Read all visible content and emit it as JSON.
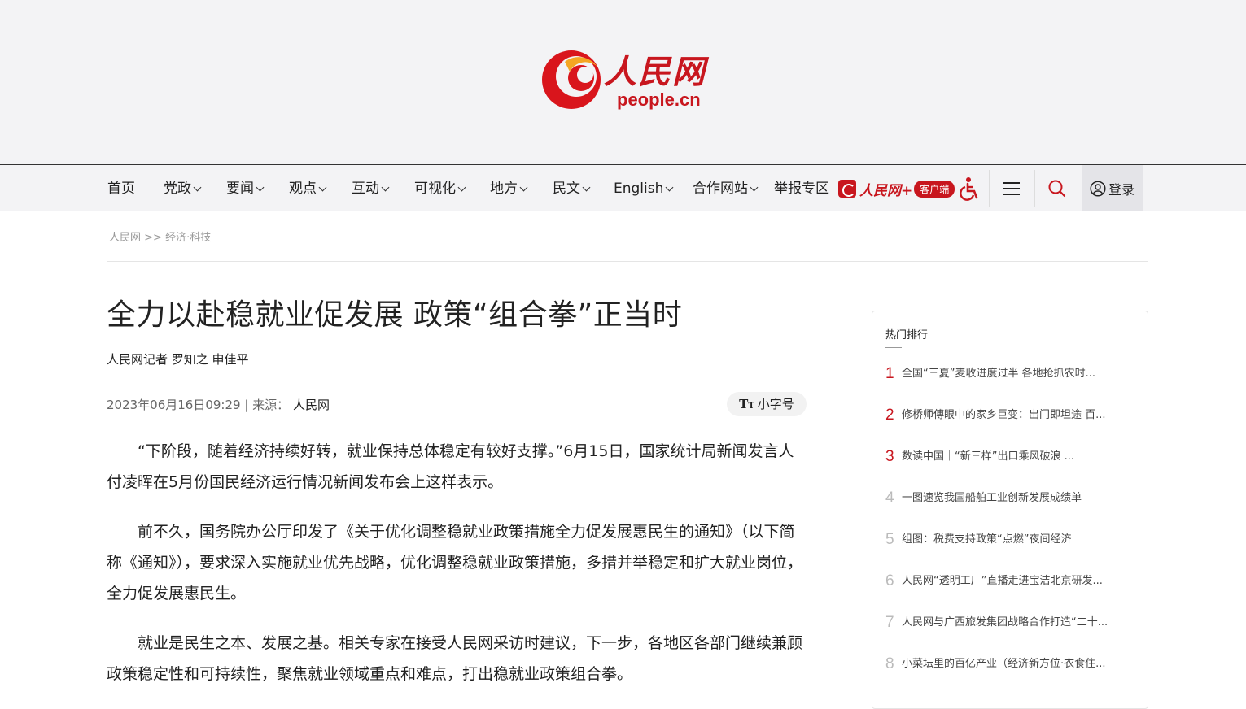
{
  "brand": {
    "name": "人民网",
    "domain": "people.cn",
    "accent_color": "#c8161e"
  },
  "nav": {
    "items": [
      {
        "label": "首页",
        "dropdown": false
      },
      {
        "label": "党政",
        "dropdown": true
      },
      {
        "label": "要闻",
        "dropdown": true
      },
      {
        "label": "观点",
        "dropdown": true
      },
      {
        "label": "互动",
        "dropdown": true
      },
      {
        "label": "可视化",
        "dropdown": true
      },
      {
        "label": "地方",
        "dropdown": true
      },
      {
        "label": "民文",
        "dropdown": true
      },
      {
        "label": "English",
        "dropdown": true
      },
      {
        "label": "合作网站",
        "dropdown": true
      },
      {
        "label": "举报专区",
        "dropdown": false
      }
    ],
    "app_badge": {
      "name": "人民网+",
      "tag": "客户端"
    },
    "accessibility_icon": "wheelchair-icon",
    "menu_icon": "hamburger-menu-icon",
    "search_icon": "search-icon",
    "login_label": "登录"
  },
  "breadcrumb": {
    "home": "人民网",
    "separator": ">>",
    "section": "经济·科技"
  },
  "article": {
    "title": "全力以赴稳就业促发展 政策“组合拳”正当时",
    "author": "人民网记者 罗知之 申佳平",
    "datetime": "2023年06月16日09:29",
    "source_prefix": "| 来源：",
    "source": "人民网",
    "font_toggle_label": "小字号",
    "paragraphs": [
      "“下阶段，随着经济持续好转，就业保持总体稳定有较好支撑。”6月15日，国家统计局新闻发言人付凌晖在5月份国民经济运行情况新闻发布会上这样表示。",
      "前不久，国务院办公厅印发了《关于优化调整稳就业政策措施全力促发展惠民生的通知》（以下简称《通知》），要求深入实施就业优先战略，优化调整稳就业政策措施，多措并举稳定和扩大就业岗位，全力促发展惠民生。",
      "就业是民生之本、发展之基。相关专家在接受人民网采访时建议，下一步，各地区各部门继续兼顾政策稳定性和可持续性，聚焦就业领域重点和难点，打出稳就业政策组合拳。"
    ]
  },
  "sidebar": {
    "title": "热门排行",
    "items": [
      {
        "rank": "1",
        "text": "全国“三夏”麦收进度过半 各地抢抓农时..."
      },
      {
        "rank": "2",
        "text": "修桥师傅眼中的家乡巨变：出门即坦途 百..."
      },
      {
        "rank": "3",
        "text": "数读中国｜“新三样”出口乘风破浪 ..."
      },
      {
        "rank": "4",
        "text": "一图速览我国船舶工业创新发展成绩单"
      },
      {
        "rank": "5",
        "text": "组图：税费支持政策“点燃”夜间经济"
      },
      {
        "rank": "6",
        "text": "人民网“透明工厂”直播走进宝洁北京研发..."
      },
      {
        "rank": "7",
        "text": "人民网与广西旅发集团战略合作打造“二十..."
      },
      {
        "rank": "8",
        "text": "小菜坛里的百亿产业（经济新方位·衣食住..."
      }
    ]
  }
}
